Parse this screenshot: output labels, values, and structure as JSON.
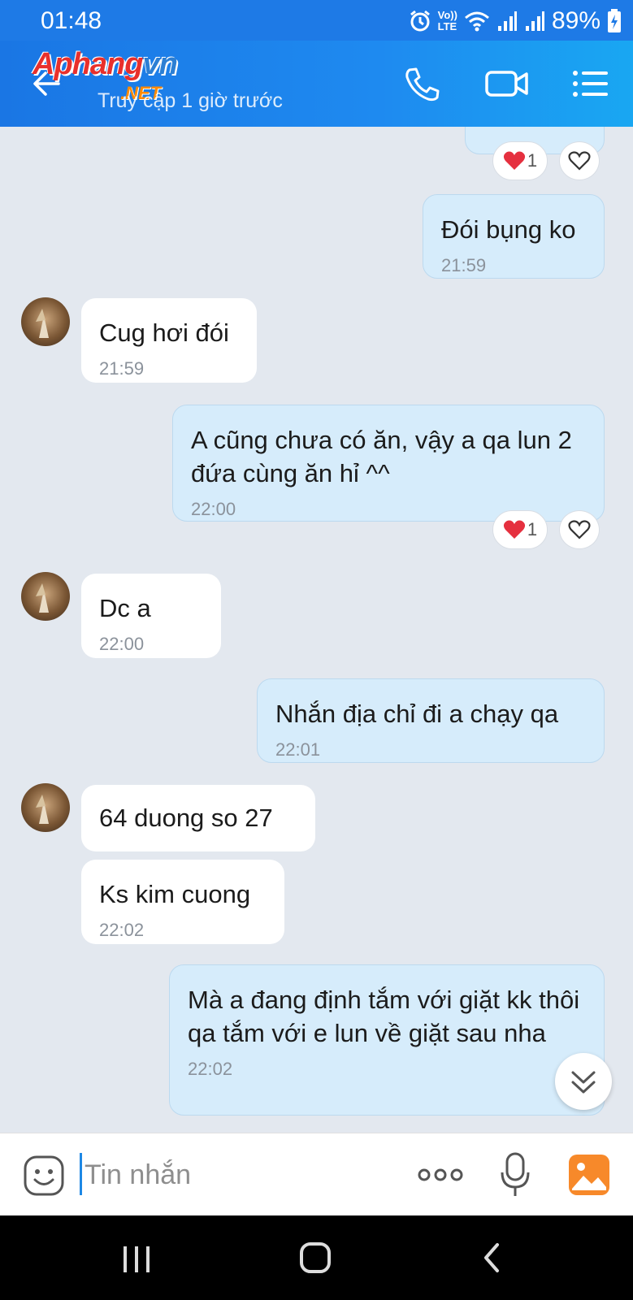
{
  "status_bar": {
    "time": "01:48",
    "battery": "89%",
    "network_label_top": "Vo))",
    "network_label_bottom": "LTE"
  },
  "header": {
    "brand_top": "Aphang",
    "brand_top_b": "vn",
    "brand_bottom": ".NET",
    "subtitle": "Truy cập 1 giờ trước"
  },
  "messages": [
    {
      "from": "me",
      "text": "Đói bụng ko",
      "time": "21:59"
    },
    {
      "from": "them",
      "text": "Cug hơi đói",
      "time": "21:59"
    },
    {
      "from": "me",
      "text": "A cũng chưa có ăn, vậy a qa lun 2 đứa cùng ăn hỉ ^^",
      "time": "22:00",
      "reaction_count": "1"
    },
    {
      "from": "them",
      "text": "Dc a",
      "time": "22:00"
    },
    {
      "from": "me",
      "text": "Nhắn địa chỉ đi a chạy qa",
      "time": "22:01"
    },
    {
      "from": "them",
      "text": "64 duong so 27",
      "time": ""
    },
    {
      "from": "them",
      "text": "Ks kim cuong",
      "time": "22:02"
    },
    {
      "from": "me",
      "text": "Mà a đang định tắm với giặt kk thôi qa tắm với e lun về giặt sau nha",
      "time": "22:02"
    }
  ],
  "top_reaction_count": "1",
  "input": {
    "placeholder": "Tin nhắn"
  },
  "colors": {
    "header": "#1e88f0",
    "outgoing_bubble": "#d6ecfb",
    "incoming_bubble": "#ffffff",
    "background": "#e3e8ef"
  },
  "icons": [
    "back-arrow-icon",
    "phone-icon",
    "video-call-icon",
    "menu-icon",
    "heart-icon",
    "emoji-icon",
    "more-icon",
    "microphone-icon",
    "image-icon",
    "chevrons-down-icon"
  ]
}
